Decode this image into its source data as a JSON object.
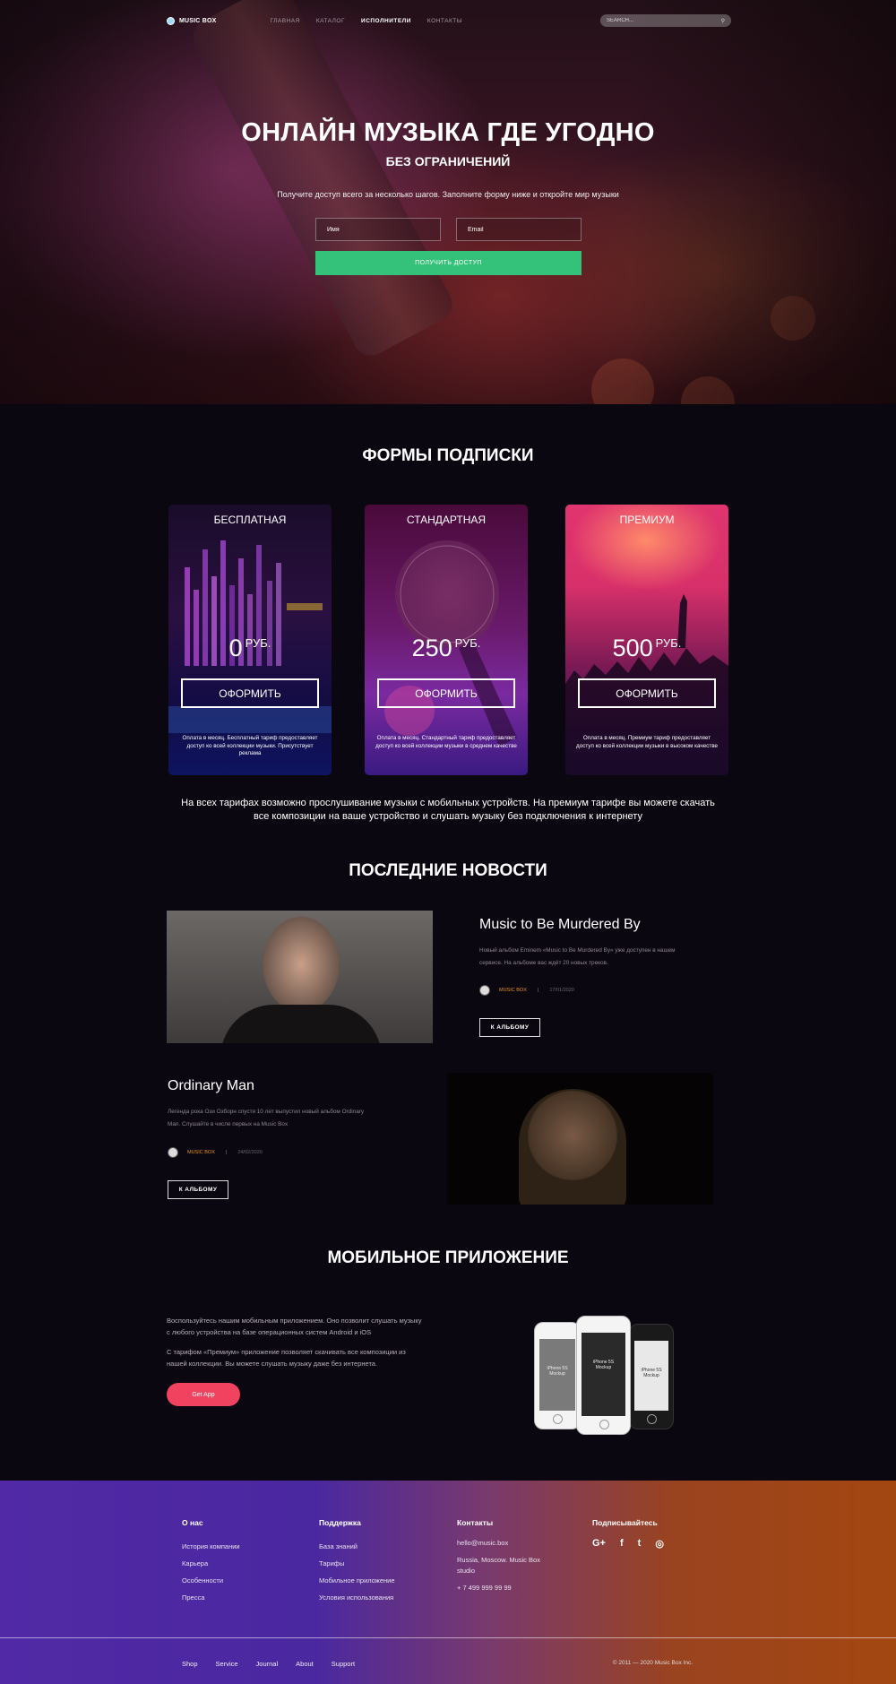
{
  "nav": {
    "logo": "MUSIC BOX",
    "items": [
      "ГЛАВНАЯ",
      "КАТАЛОГ",
      "ИСПОЛНИТЕЛИ",
      "КОНТАКТЫ"
    ],
    "search_placeholder": "SEARCH..."
  },
  "hero": {
    "title": "ОНЛАЙН МУЗЫКА ГДЕ УГОДНО",
    "subtitle": "БЕЗ ОГРАНИЧЕНИЙ",
    "lead": "Получите доступ всего за несколько шагов. Заполните форму ниже и откройте мир музыки",
    "name_placeholder": "Имя",
    "email_placeholder": "Email",
    "button": "ПОЛУЧИТЬ ДОСТУП"
  },
  "plans": {
    "title": "ФОРМЫ ПОДПИСКИ",
    "items": [
      {
        "name": "БЕСПЛАТНАЯ",
        "price": "0",
        "currency": "РУБ.",
        "button": "ОФОРМИТЬ",
        "desc": "Оплата в месяц. Бесплатный тариф предоставляет доступ ко всей коллекции музыки. Присутствует реклама"
      },
      {
        "name": "СТАНДАРТНАЯ",
        "price": "250",
        "currency": "РУБ.",
        "button": "ОФОРМИТЬ",
        "desc": "Оплата в месяц. Стандартный тариф предоставляет доступ ко всей коллекции музыки в среднем качестве"
      },
      {
        "name": "ПРЕМИУМ",
        "price": "500",
        "currency": "РУБ.",
        "button": "ОФОРМИТЬ",
        "desc": "Оплата в месяц. Премиум тариф предоставляет доступ ко всей коллекции музыки в высоком качестве"
      }
    ],
    "note_line1": "На всех тарифах возможно прослушивание музыки с мобильных устройств. На премиум тарифе вы можете скачать",
    "note_line2": "все композиции на ваше устройство и слушать музыку без подключения к интернету"
  },
  "news": {
    "title": "ПОСЛЕДНИЕ НОВОСТИ",
    "items": [
      {
        "title": "Music to Be Murdered By",
        "text1": "Новый альбом Eminem «Music to Be Murdered By» уже доступен в нашем",
        "text2": "сервисе. На альбоме вас ждёт 20 новых треков.",
        "author": "MUSIC BOX",
        "sep": "|",
        "date": "17/01/2020",
        "button": "К АЛЬБОМУ"
      },
      {
        "title": "Ordinary Man",
        "text1": "Легенда рока Ози Озборн спустя 10 лет выпустил новый альбом Ordinary",
        "text2": "Man. Слушайте в числе первых на Music Box",
        "author": "MUSIC BOX",
        "sep": "|",
        "date": "24/02/2020",
        "button": "К АЛЬБОМУ"
      }
    ]
  },
  "app": {
    "title": "МОБИЛЬНОЕ ПРИЛОЖЕНИЕ",
    "p1a": "Воспользуйтесь нашим мобильным приложением. Оно позволит слушать музыку",
    "p1b": "с любого устройства на базе операционных систем Android и iOS",
    "p2a": "С тарифом «Премиум» приложение позволяет скачивать все композиции из",
    "p2b": "нашей коллекции. Вы можете слушать музыку даже без интернета.",
    "button": "Get App",
    "phone_label": "iPhone 5S",
    "phone_sub": "Mockup"
  },
  "footer": {
    "about": {
      "title": "О нас",
      "items": [
        "История компании",
        "Карьера",
        "Особенности",
        "Пресса"
      ]
    },
    "support": {
      "title": "Поддержка",
      "items": [
        "База знаний",
        "Тарифы",
        "Мобильное приложение",
        "Условия использования"
      ]
    },
    "contacts": {
      "title": "Контакты",
      "email": "hello@music.box",
      "address1": "Russia, Moscow. Music Box",
      "address2": "studio",
      "phone": "+ 7 499 999 99 99"
    },
    "subscribe": {
      "title": "Подписывайтесь",
      "icons": [
        "G+",
        "f",
        "t",
        "◎"
      ]
    },
    "bottom_links": [
      "Shop",
      "Service",
      "Journal",
      "About",
      "Support"
    ],
    "copyright": "© 2011 — 2020 Music Box Inc."
  }
}
